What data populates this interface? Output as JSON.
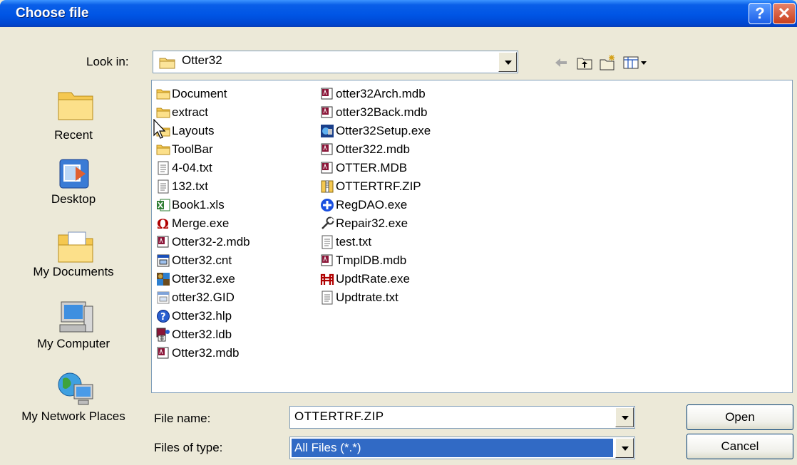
{
  "window": {
    "title": "Choose file"
  },
  "look_in": {
    "label": "Look in:",
    "value": "Otter32"
  },
  "toolbar": {
    "icons": [
      "back-arrow-icon",
      "up-folder-icon",
      "new-folder-icon",
      "view-menu-icon"
    ]
  },
  "places": [
    {
      "label": "Recent",
      "icon": "recent-folder-icon"
    },
    {
      "label": "Desktop",
      "icon": "desktop-icon"
    },
    {
      "label": "My Documents",
      "icon": "my-documents-icon"
    },
    {
      "label": "My Computer",
      "icon": "my-computer-icon"
    },
    {
      "label": "My Network Places",
      "icon": "network-places-icon"
    }
  ],
  "files": {
    "col1": [
      {
        "name": "Document",
        "icon": "folder-icon"
      },
      {
        "name": "extract",
        "icon": "folder-icon"
      },
      {
        "name": "Layouts",
        "icon": "folder-icon"
      },
      {
        "name": "ToolBar",
        "icon": "folder-icon"
      },
      {
        "name": "4-04.txt",
        "icon": "text-file-icon"
      },
      {
        "name": "132.txt",
        "icon": "text-file-icon"
      },
      {
        "name": "Book1.xls",
        "icon": "excel-file-icon"
      },
      {
        "name": "Merge.exe",
        "icon": "merge-exe-icon"
      },
      {
        "name": "Otter32-2.mdb",
        "icon": "access-db-icon"
      },
      {
        "name": "Otter32.cnt",
        "icon": "cnt-file-icon"
      },
      {
        "name": "Otter32.exe",
        "icon": "otter-exe-icon"
      },
      {
        "name": "otter32.GID",
        "icon": "gid-file-icon"
      },
      {
        "name": "Otter32.hlp",
        "icon": "help-file-icon"
      },
      {
        "name": "Otter32.ldb",
        "icon": "ldb-file-icon"
      },
      {
        "name": "Otter32.mdb",
        "icon": "access-db-icon"
      }
    ],
    "col2": [
      {
        "name": "otter32Arch.mdb",
        "icon": "access-db-icon"
      },
      {
        "name": "otter32Back.mdb",
        "icon": "access-db-icon"
      },
      {
        "name": "Otter32Setup.exe",
        "icon": "setup-exe-icon"
      },
      {
        "name": "Otter322.mdb",
        "icon": "access-db-icon"
      },
      {
        "name": "OTTER.MDB",
        "icon": "access-db-icon"
      },
      {
        "name": "OTTERTRF.ZIP",
        "icon": "zip-file-icon"
      },
      {
        "name": "RegDAO.exe",
        "icon": "regdao-exe-icon"
      },
      {
        "name": "Repair32.exe",
        "icon": "repair-exe-icon"
      },
      {
        "name": "test.txt",
        "icon": "text-file-icon"
      },
      {
        "name": "TmplDB.mdb",
        "icon": "access-db-icon"
      },
      {
        "name": "UpdtRate.exe",
        "icon": "updtrate-exe-icon"
      },
      {
        "name": "Updtrate.txt",
        "icon": "text-file-icon"
      }
    ]
  },
  "file_name": {
    "label": "File name:",
    "value": "OTTERTRF.ZIP"
  },
  "file_type": {
    "label": "Files of type:",
    "value": "All Files (*.*)"
  },
  "buttons": {
    "open": "Open",
    "cancel": "Cancel"
  }
}
